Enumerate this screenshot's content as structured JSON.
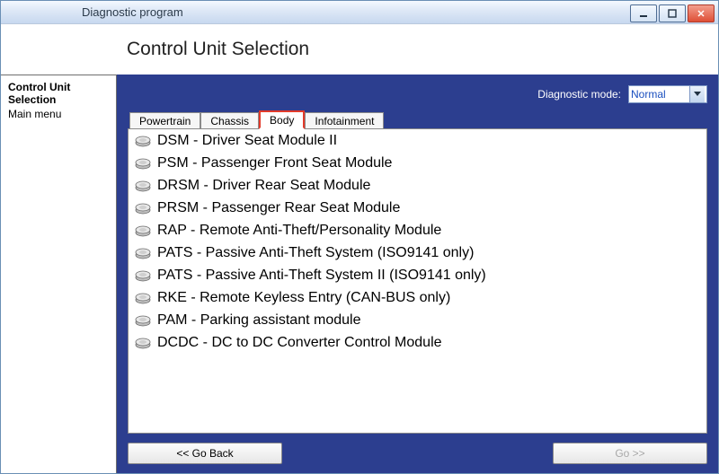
{
  "window": {
    "title": "Diagnostic program"
  },
  "page": {
    "title": "Control Unit Selection"
  },
  "sidebar": {
    "items": [
      {
        "label": "Control Unit Selection",
        "bold": true
      },
      {
        "label": "Main menu",
        "bold": false
      }
    ]
  },
  "mode": {
    "label": "Diagnostic mode:",
    "value": "Normal"
  },
  "tabs": [
    {
      "label": "Powertrain",
      "active": false
    },
    {
      "label": "Chassis",
      "active": false
    },
    {
      "label": "Body",
      "active": true
    },
    {
      "label": "Infotainment",
      "active": false
    }
  ],
  "list": [
    "DSM - Driver Seat Module II",
    "PSM - Passenger Front Seat Module",
    "DRSM - Driver Rear Seat Module",
    "PRSM - Passenger Rear Seat Module",
    "RAP - Remote Anti-Theft/Personality Module",
    "PATS - Passive Anti-Theft System (ISO9141 only)",
    "PATS - Passive Anti-Theft System II (ISO9141 only)",
    "RKE - Remote Keyless Entry (CAN-BUS only)",
    "PAM - Parking assistant module",
    "DCDC - DC to DC Converter Control Module"
  ],
  "footer": {
    "back": "<< Go Back",
    "go": "Go >>"
  }
}
